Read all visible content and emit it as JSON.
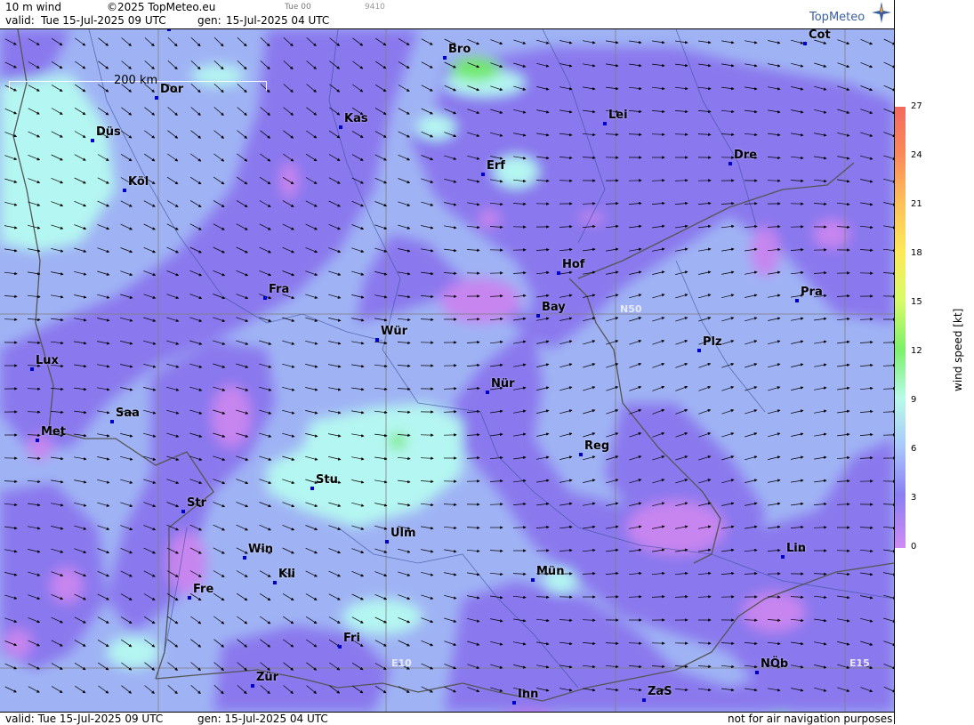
{
  "header": {
    "product": "10 m wind",
    "copyright": "©2025 TopMeteo.eu",
    "valid_label": "valid:",
    "valid_time": "Tue  15-Jul-2025  09 UTC",
    "gen_label": "gen:",
    "gen_time": "15-Jul-2025 04 UTC",
    "small_time": "Tue 00",
    "code": "9410",
    "logo": "TopMeteo"
  },
  "footer": {
    "valid": "valid:  Tue  15-Jul-2025  09 UTC",
    "gen": "gen: 15-Jul-2025 04 UTC",
    "disclaimer": "not for air navigation purposes"
  },
  "scale_bar": {
    "label": "200 km"
  },
  "grid_labels": {
    "lat": "N50",
    "lon1": "E10",
    "lon2": "E15"
  },
  "cities": [
    {
      "name": "Mün",
      "id": "mun-top"
    },
    {
      "name": "Bro",
      "id": "bro"
    },
    {
      "name": "Cot",
      "id": "cot"
    },
    {
      "name": "Dor",
      "id": "dor"
    },
    {
      "name": "Kas",
      "id": "kas"
    },
    {
      "name": "Lei",
      "id": "lei"
    },
    {
      "name": "Düs",
      "id": "dus"
    },
    {
      "name": "Erf",
      "id": "erf"
    },
    {
      "name": "Dre",
      "id": "dre"
    },
    {
      "name": "Köl",
      "id": "kol"
    },
    {
      "name": "Hof",
      "id": "hof"
    },
    {
      "name": "Fra",
      "id": "fra"
    },
    {
      "name": "Pra",
      "id": "pra"
    },
    {
      "name": "Bay",
      "id": "bay"
    },
    {
      "name": "Wür",
      "id": "wur"
    },
    {
      "name": "Plz",
      "id": "plz"
    },
    {
      "name": "Lux",
      "id": "lux"
    },
    {
      "name": "Nür",
      "id": "nur"
    },
    {
      "name": "Saa",
      "id": "saa"
    },
    {
      "name": "Met",
      "id": "met"
    },
    {
      "name": "Reg",
      "id": "reg"
    },
    {
      "name": "Stu",
      "id": "stu"
    },
    {
      "name": "Str",
      "id": "str"
    },
    {
      "name": "Ulm",
      "id": "ulm"
    },
    {
      "name": "Win",
      "id": "win"
    },
    {
      "name": "Lin",
      "id": "lin"
    },
    {
      "name": "Kli",
      "id": "kli"
    },
    {
      "name": "Mün",
      "id": "mun"
    },
    {
      "name": "Fre",
      "id": "fre"
    },
    {
      "name": "Fri",
      "id": "fri"
    },
    {
      "name": "NÖb",
      "id": "nob"
    },
    {
      "name": "Zür",
      "id": "zur"
    },
    {
      "name": "ZaS",
      "id": "zas"
    },
    {
      "name": "Inn",
      "id": "inn"
    }
  ],
  "legend": {
    "title": "wind speed [kt]",
    "ticks": [
      "27",
      "24",
      "21",
      "18",
      "15",
      "12",
      "9",
      "6",
      "3",
      "0"
    ],
    "colors": [
      "#f26a5e",
      "#fba65a",
      "#fde95a",
      "#e8fb6a",
      "#7cf06a",
      "#b8fbe8",
      "#a9c8fb",
      "#8a7ff2",
      "#c88af0"
    ]
  },
  "colors": {
    "base": "#9fb3f4",
    "violet": "#8a78ee",
    "magenta": "#c785ef",
    "cyan": "#b4f6f1",
    "green": "#72e86a"
  }
}
